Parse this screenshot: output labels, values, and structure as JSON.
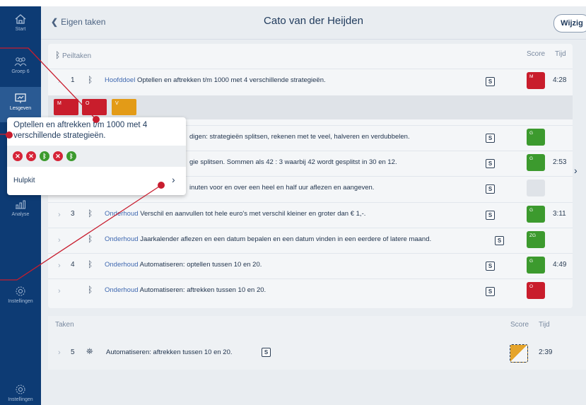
{
  "sidebar": {
    "items": [
      {
        "label": "Start",
        "icon": "home-icon"
      },
      {
        "label": "Groep 6",
        "icon": "group-icon"
      },
      {
        "label": "Lesgeven",
        "icon": "lesson-icon"
      },
      {
        "label": "Analyse",
        "icon": "chart-icon"
      },
      {
        "label": "Instellingen",
        "icon": "gear-icon"
      },
      {
        "label": "Instellingen",
        "icon": "gear-icon"
      }
    ]
  },
  "header": {
    "back_label": "Eigen taken",
    "title": "Cato van der Heijden",
    "edit_button": "Wijzig"
  },
  "peiltaken": {
    "section_label": "Peiltaken",
    "score_header": "Score",
    "time_header": "Tijd",
    "rows": [
      {
        "num": "1",
        "tag": "Hoofddoel",
        "text": "Optellen en aftrekken t/m 1000 met 4 verschillende strategieën.",
        "score": "M",
        "score_color": "#c91d2c",
        "time": "4:28"
      },
      {
        "num": "",
        "tag": "",
        "text": "digen: strategieën splitsen, rekenen met te veel, halveren en verdubbelen.",
        "score": "G",
        "score_color": "#3c9a2e",
        "time": ""
      },
      {
        "num": "",
        "tag": "",
        "text": "gie splitsen. Sommen als 42 : 3 waarbij 42 wordt gesplitst in 30 en 12.",
        "score": "G",
        "score_color": "#3c9a2e",
        "time": "2:53"
      },
      {
        "num": "",
        "tag": "",
        "text": "inuten voor en over een heel en half uur aflezen en aangeven.",
        "score": "",
        "score_color": "#dfe3e8",
        "time": ""
      },
      {
        "num": "3",
        "tag": "Onderhoud",
        "text": "Verschil en aanvullen tot hele euro's met verschil kleiner en groter dan € 1,-.",
        "score": "G",
        "score_color": "#3c9a2e",
        "time": "3:11"
      },
      {
        "num": "",
        "tag": "Onderhoud",
        "text": "Jaarkalender aflezen en een datum bepalen en een datum vinden in een eerdere of latere maand.",
        "score": "ZG",
        "score_color": "#3c9a2e",
        "time": ""
      },
      {
        "num": "4",
        "tag": "Onderhoud",
        "text": "Automatiseren: optellen tussen 10 en 20.",
        "score": "G",
        "score_color": "#3c9a2e",
        "time": "4:49"
      },
      {
        "num": "",
        "tag": "Onderhoud",
        "text": "Automatiseren: aftrekken tussen 10 en 20.",
        "score": "O",
        "score_color": "#c91d2c",
        "time": ""
      }
    ],
    "chips": [
      {
        "label": "M",
        "color": "#c91d2c"
      },
      {
        "label": "O",
        "color": "#c91d2c"
      },
      {
        "label": "V",
        "color": "#e39b17"
      }
    ],
    "s_label": "S"
  },
  "popup": {
    "title": "Optellen en aftrekken t/m 1000 met 4 verschillende strategieën.",
    "results": [
      "x",
      "x",
      "ok",
      "x",
      "ok"
    ],
    "hulpkit_label": "Hulpkit",
    "arrow": "›"
  },
  "taken": {
    "section_label": "Taken",
    "score_header": "Score",
    "time_header": "Tijd",
    "rows": [
      {
        "num": "5",
        "text": "Automatiseren: aftrekken tussen 10 en 20.",
        "time": "2:39"
      }
    ]
  },
  "colors": {
    "sidebar": "#0d3b74",
    "accent_red": "#c81d2e",
    "green": "#3c9a2e"
  }
}
